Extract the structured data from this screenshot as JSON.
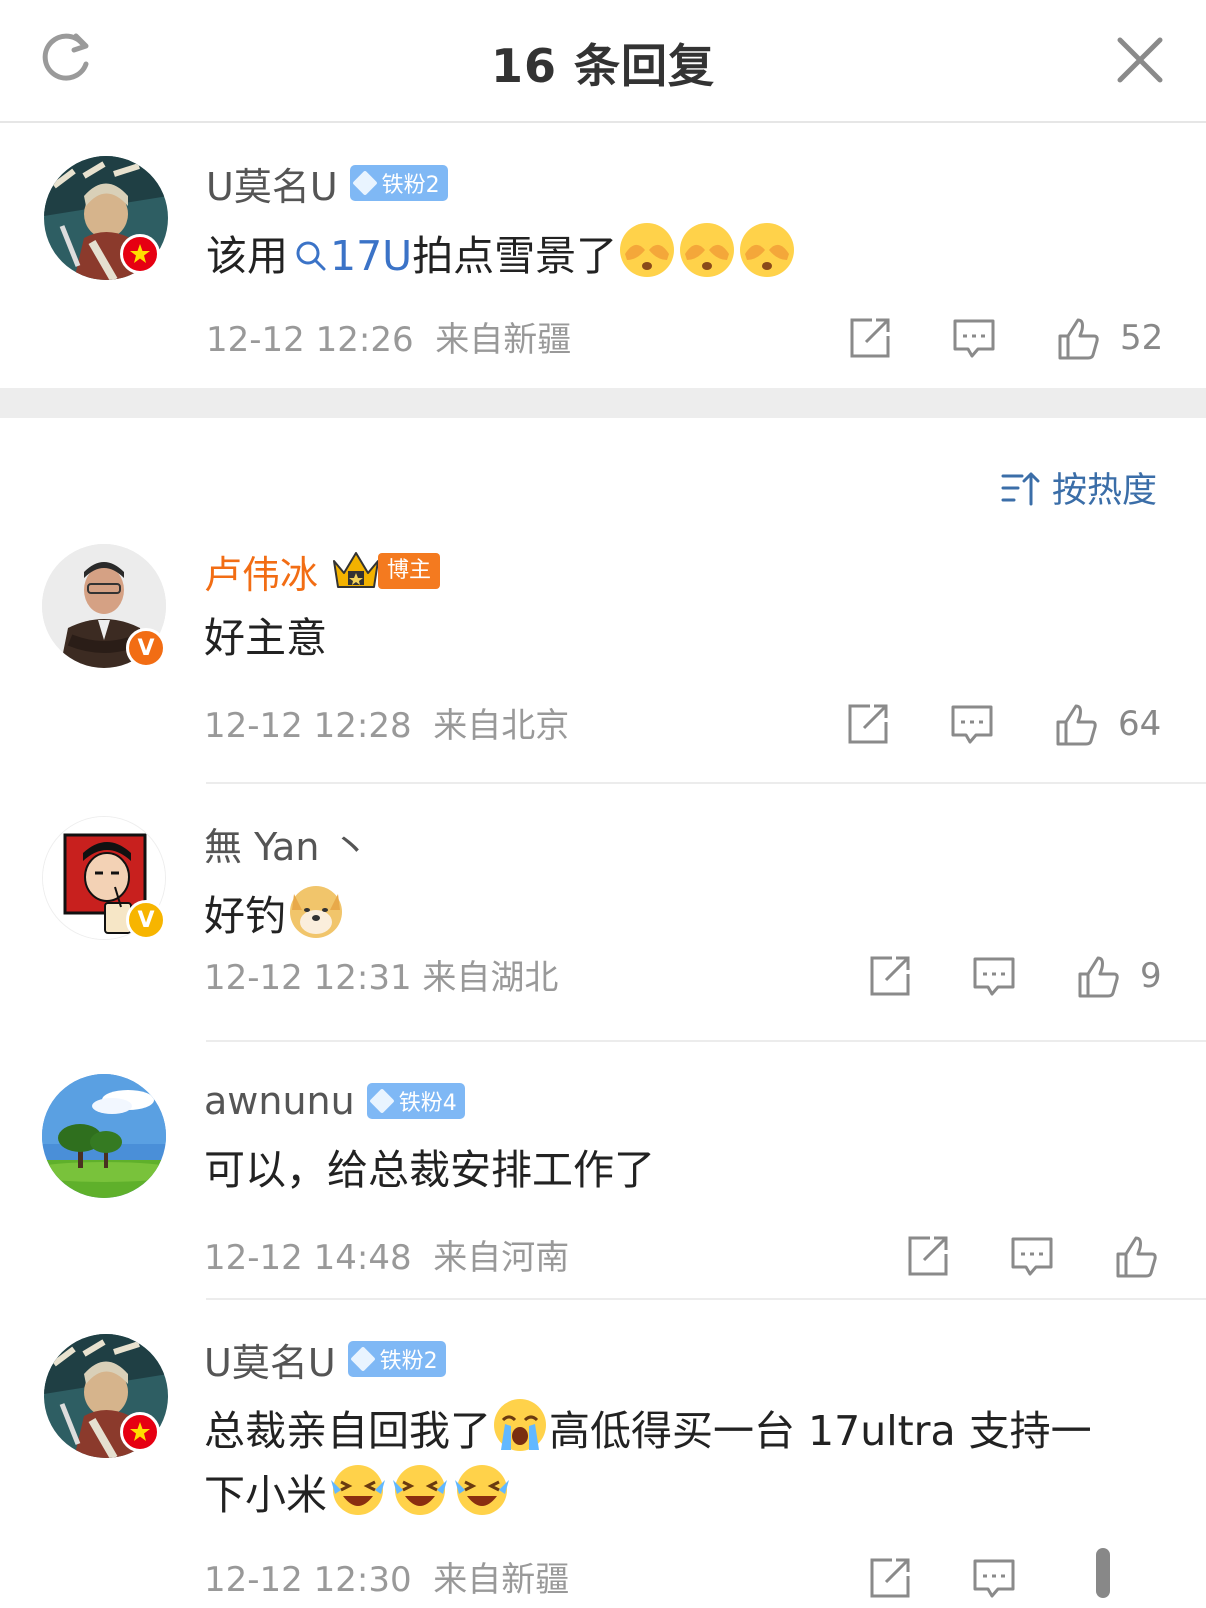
{
  "header": {
    "title": "16 条回复",
    "refresh_icon": "refresh-icon",
    "close_icon": "close-icon"
  },
  "root_comment": {
    "user": "U莫名U",
    "fan_badge": "铁粉2",
    "text_before": "该用",
    "topic_link": "17U",
    "text_after": "拍点雪景了",
    "emojis": [
      "shy-emoji",
      "shy-emoji",
      "shy-emoji"
    ],
    "time": "12-12 12:26",
    "location": "来自新疆",
    "likes": "52"
  },
  "sort": {
    "label": "按热度",
    "icon": "sort-icon"
  },
  "replies": [
    {
      "user": "卢伟冰",
      "blogger_tag": "博主",
      "text": "好主意",
      "time": "12-12 12:28",
      "location": "来自北京",
      "likes": "64"
    },
    {
      "user": "無 Yan 丶",
      "text": "好钓",
      "emoji": "doge-emoji",
      "time": "12-12 12:31",
      "location": "来自湖北",
      "likes": "9"
    },
    {
      "user": "awnunu",
      "fan_badge": "铁粉4",
      "text": "可以，给总裁安排工作了",
      "time": "12-12 14:48",
      "location": "来自河南",
      "likes": ""
    },
    {
      "user": "U莫名U",
      "fan_badge": "铁粉2",
      "text_line1_a": "总裁亲自回我了",
      "text_line1_b": "高低得买一台 17ultra 支持一",
      "text_line2": "下小米",
      "emojis": [
        "cry-emoji",
        "laugh-cry-emoji",
        "laugh-cry-emoji",
        "laugh-cry-emoji"
      ],
      "time": "12-12 12:30",
      "location": "来自新疆"
    }
  ],
  "colors": {
    "link": "#3b73c7",
    "blogger_name": "#f26d14",
    "fan_badge": "#7fb8f5",
    "meta": "#999999"
  }
}
